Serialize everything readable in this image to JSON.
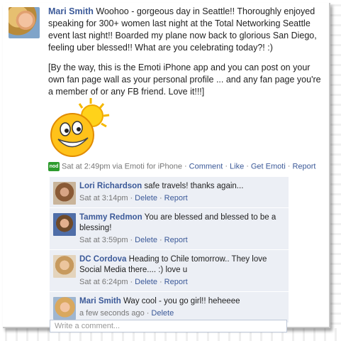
{
  "post": {
    "author": "Mari Smith",
    "text": "Woohoo - gorgeous day in Seattle!! Thoroughly enjoyed speaking for 300+ women last night at the Total Networking Seattle event last night!! Boarded my plane now back to glorious San Diego, feeling uber blessed!! What are you celebrating today?! :)",
    "paragraph2": "[By the way, this is the Emoti iPhone app and you can post on your own fan page wall as your personal profile ... and any fan page you're a member of or any FB friend. Love it!!!]",
    "app_badge": "nod",
    "timestamp": "Sat at 2:49pm via Emoti for iPhone",
    "actions": [
      "Comment",
      "Like",
      "Get Emoti",
      "Report"
    ]
  },
  "comments": [
    {
      "author": "Lori Richardson",
      "text": "safe travels! thanks again...",
      "time": "Sat at 3:14pm",
      "actions": [
        "Delete",
        "Report"
      ]
    },
    {
      "author": "Tammy Redmon",
      "text": "You are blessed and blessed to be a blessing!",
      "time": "Sat at 3:59pm",
      "actions": [
        "Delete",
        "Report"
      ]
    },
    {
      "author": "DC Cordova",
      "text": "Heading to Chile tomorrow.. They love Social Media there.... :) love u",
      "time": "Sat at 6:24pm",
      "actions": [
        "Delete",
        "Report"
      ]
    },
    {
      "author": "Mari Smith",
      "text": "Way cool - you go girl!! heheeee",
      "time": "a few seconds ago",
      "actions": [
        "Delete"
      ]
    }
  ],
  "write_comment": {
    "placeholder": "Write a comment..."
  },
  "colors": {
    "link": "#3b5998",
    "comment_bg": "#eceff5"
  }
}
